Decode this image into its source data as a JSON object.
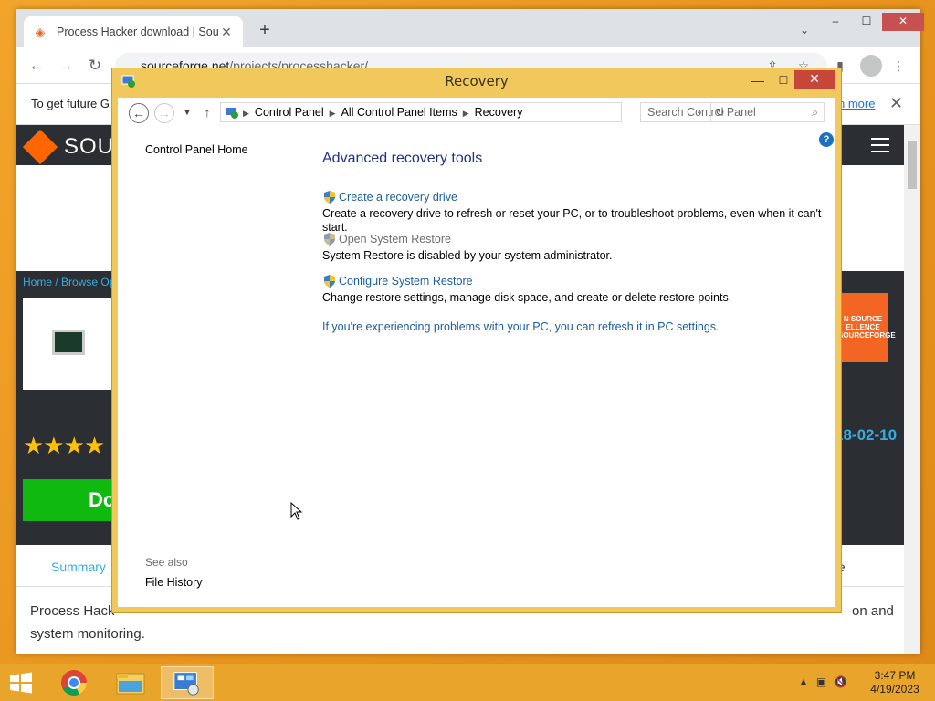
{
  "browser": {
    "tab_title": "Process Hacker download | Sourc",
    "new_tab": "+",
    "url_host": "sourceforge.net",
    "url_path": "/projects/processhacker/",
    "infobar_text": "To get future G",
    "infobar_link": "n more",
    "window_buttons": {
      "minimize": "–",
      "maximize": "☐",
      "close": "✕"
    }
  },
  "page": {
    "logo_text": "SOU",
    "breadcrumb_home": "Home",
    "breadcrumb_sep": " / ",
    "breadcrumb_next": "Browse Op",
    "stars": "★★★★",
    "download_label": "Do",
    "badge_text": "N SOURCE ELLENCE SOURCEFORGE",
    "date_text": "18-02-10",
    "summary_tab": "Summary",
    "edit_tab": "te",
    "description_line1": "Process Hack",
    "description_tail1": "on and",
    "description_line2": "system monitoring."
  },
  "recovery": {
    "title": "Recovery",
    "address": [
      "Control Panel",
      "All Control Panel Items",
      "Recovery"
    ],
    "search_placeholder": "Search Control Panel",
    "sidebar_home": "Control Panel Home",
    "heading": "Advanced recovery tools",
    "tools": [
      {
        "label": "Create a recovery drive",
        "desc": "Create a recovery drive to refresh or reset your PC, or to troubleshoot problems, even when it can't start.",
        "enabled": true
      },
      {
        "label": "Open System Restore",
        "desc": "System Restore is disabled by your system administrator.",
        "enabled": false
      },
      {
        "label": "Configure System Restore",
        "desc": "Change restore settings, manage disk space, and create or delete restore points.",
        "enabled": true
      }
    ],
    "refresh_link": "If you're experiencing problems with your PC, you can refresh it in PC settings.",
    "see_also": "See also",
    "file_history": "File History"
  },
  "taskbar": {
    "time": "3:47 PM",
    "date": "4/19/2023"
  },
  "colors": {
    "accent": "#e9a42b",
    "link": "#1c5d9c",
    "heading": "#1e3287",
    "window_frame": "#f0c85c",
    "close_red": "#c7463a"
  }
}
